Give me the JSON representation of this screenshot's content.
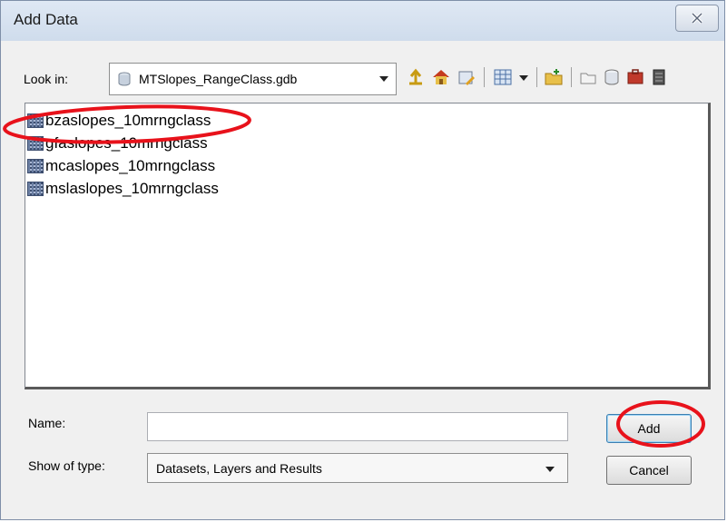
{
  "window": {
    "title": "Add Data",
    "close_symbol": "✕"
  },
  "look_in": {
    "label": "Look in:",
    "value": "MTSlopes_RangeClass.gdb",
    "icon": "database-icon"
  },
  "toolbar": {
    "icons": [
      "up-one-level-icon",
      "home-icon",
      "connect-folder-icon",
      "view-list-icon",
      "view-dropdown-icon",
      "new-folder-icon",
      "catalog-icon",
      "geodatabase-icon",
      "toolbox-icon",
      "server-icon"
    ]
  },
  "files": [
    {
      "name": "bzaslopes_10mrngclass",
      "icon": "raster-icon"
    },
    {
      "name": "gfaslopes_10mrngclass",
      "icon": "raster-icon"
    },
    {
      "name": "mcaslopes_10mrngclass",
      "icon": "raster-icon"
    },
    {
      "name": "mslaslopes_10mrngclass",
      "icon": "raster-icon"
    }
  ],
  "name_field": {
    "label": "Name:",
    "value": ""
  },
  "type_field": {
    "label": "Show of type:",
    "value": "Datasets, Layers and Results"
  },
  "buttons": {
    "add_label": "Add",
    "cancel_label": "Cancel"
  },
  "annotation_color": "#e8121b"
}
